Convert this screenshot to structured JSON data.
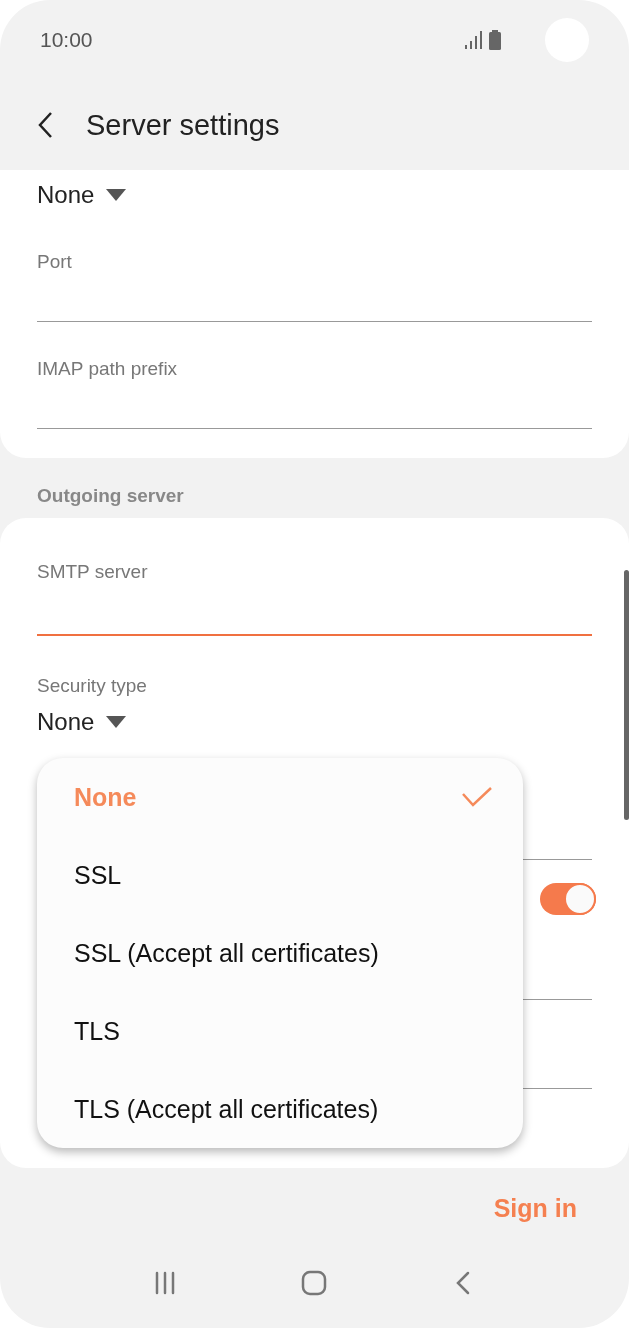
{
  "status_bar": {
    "time": "10:00"
  },
  "header": {
    "title": "Server settings"
  },
  "incoming": {
    "security_value": "None",
    "fields": [
      {
        "label": "Port"
      },
      {
        "label": "IMAP path prefix"
      }
    ]
  },
  "outgoing": {
    "section_title": "Outgoing server",
    "fields": [
      {
        "label": "SMTP server",
        "focused": true
      }
    ],
    "security": {
      "label": "Security type",
      "value": "None"
    },
    "toggle": {
      "on": true
    }
  },
  "dropdown": {
    "options": [
      {
        "label": "None",
        "selected": true
      },
      {
        "label": "SSL",
        "selected": false
      },
      {
        "label": "SSL (Accept all certificates)",
        "selected": false
      },
      {
        "label": "TLS",
        "selected": false
      },
      {
        "label": "TLS (Accept all certificates)",
        "selected": false
      }
    ]
  },
  "footer": {
    "sign_in": "Sign in"
  }
}
